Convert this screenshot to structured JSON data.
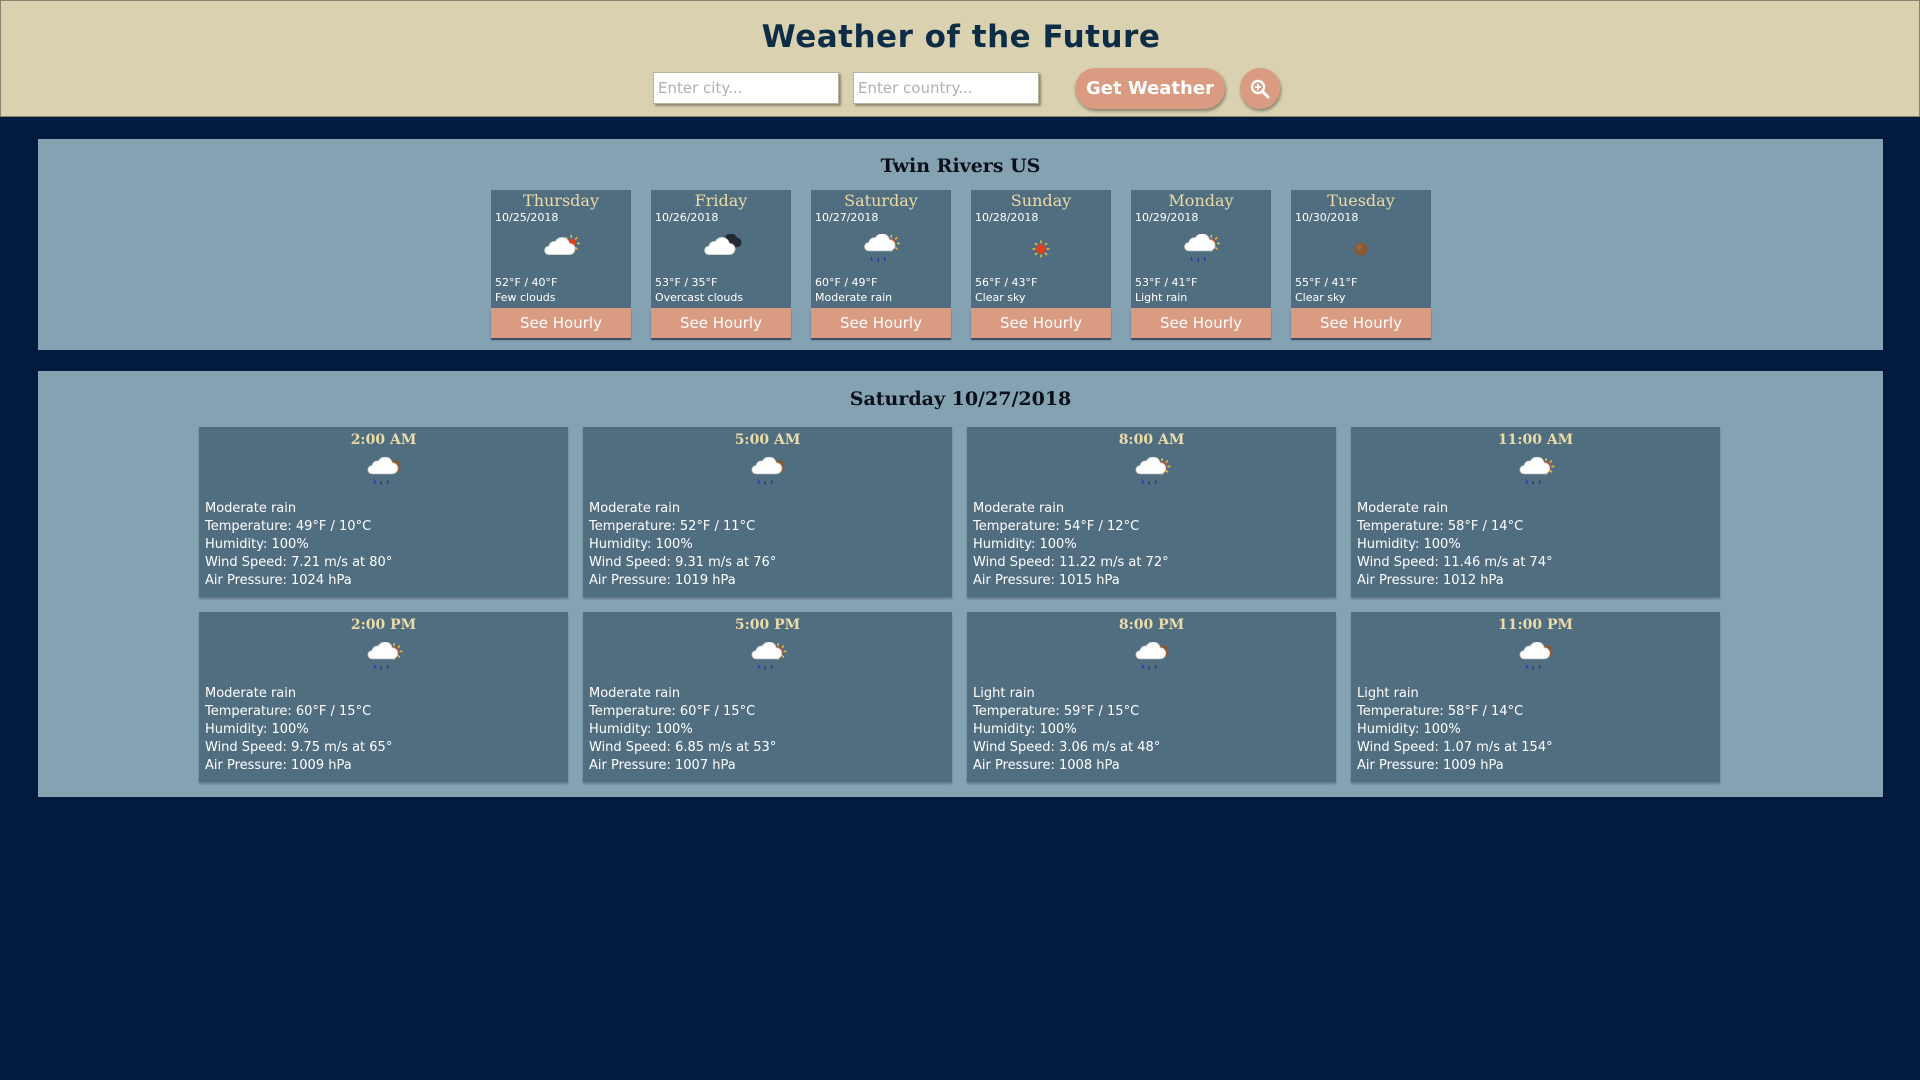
{
  "header": {
    "title": "Weather of the Future",
    "city_placeholder": "Enter city...",
    "country_placeholder": "Enter country...",
    "get_weather_label": "Get Weather",
    "zoom_icon": "zoom-icon"
  },
  "colors": {
    "background": "#011a3d",
    "header_bg": "#d9d1b0",
    "panel_bg": "#85a2b3",
    "card_bg": "#516e81",
    "accent": "#d99b82",
    "card_title": "#eadba8",
    "title_text": "#0d2d47"
  },
  "forecast": {
    "location": "Twin Rivers US",
    "days": [
      {
        "day": "Thursday",
        "date": "10/25/2018",
        "temp": "52°F / 40°F",
        "desc": "Few clouds",
        "icon": "few-clouds-day-icon",
        "button": "See Hourly"
      },
      {
        "day": "Friday",
        "date": "10/26/2018",
        "temp": "53°F / 35°F",
        "desc": "Overcast clouds",
        "icon": "overcast-clouds-night-icon",
        "button": "See Hourly"
      },
      {
        "day": "Saturday",
        "date": "10/27/2018",
        "temp": "60°F / 49°F",
        "desc": "Moderate rain",
        "icon": "rain-day-icon",
        "button": "See Hourly"
      },
      {
        "day": "Sunday",
        "date": "10/28/2018",
        "temp": "56°F / 43°F",
        "desc": "Clear sky",
        "icon": "sun-icon",
        "button": "See Hourly"
      },
      {
        "day": "Monday",
        "date": "10/29/2018",
        "temp": "53°F / 41°F",
        "desc": "Light rain",
        "icon": "rain-day-icon",
        "button": "See Hourly"
      },
      {
        "day": "Tuesday",
        "date": "10/30/2018",
        "temp": "55°F / 41°F",
        "desc": "Clear sky",
        "icon": "moon-icon",
        "button": "See Hourly"
      }
    ]
  },
  "hourly": {
    "heading": "Saturday 10/27/2018",
    "hours": [
      {
        "time": "2:00 AM",
        "icon": "rain-night-icon",
        "desc": "Moderate rain",
        "temperature": "Temperature: 49°F / 10°C",
        "humidity": "Humidity: 100%",
        "wind": "Wind Speed: 7.21 m/s at 80°",
        "pressure": "Air Pressure: 1024 hPa"
      },
      {
        "time": "5:00 AM",
        "icon": "rain-night-icon",
        "desc": "Moderate rain",
        "temperature": "Temperature: 52°F / 11°C",
        "humidity": "Humidity: 100%",
        "wind": "Wind Speed: 9.31 m/s at 76°",
        "pressure": "Air Pressure: 1019 hPa"
      },
      {
        "time": "8:00 AM",
        "icon": "rain-day-icon",
        "desc": "Moderate rain",
        "temperature": "Temperature: 54°F / 12°C",
        "humidity": "Humidity: 100%",
        "wind": "Wind Speed: 11.22 m/s at 72°",
        "pressure": "Air Pressure: 1015 hPa"
      },
      {
        "time": "11:00 AM",
        "icon": "rain-day-icon",
        "desc": "Moderate rain",
        "temperature": "Temperature: 58°F / 14°C",
        "humidity": "Humidity: 100%",
        "wind": "Wind Speed: 11.46 m/s at 74°",
        "pressure": "Air Pressure: 1012 hPa"
      },
      {
        "time": "2:00 PM",
        "icon": "rain-day-icon",
        "desc": "Moderate rain",
        "temperature": "Temperature: 60°F / 15°C",
        "humidity": "Humidity: 100%",
        "wind": "Wind Speed: 9.75 m/s at 65°",
        "pressure": "Air Pressure: 1009 hPa"
      },
      {
        "time": "5:00 PM",
        "icon": "rain-day-icon",
        "desc": "Moderate rain",
        "temperature": "Temperature: 60°F / 15°C",
        "humidity": "Humidity: 100%",
        "wind": "Wind Speed: 6.85 m/s at 53°",
        "pressure": "Air Pressure: 1007 hPa"
      },
      {
        "time": "8:00 PM",
        "icon": "rain-night-icon",
        "desc": "Light rain",
        "temperature": "Temperature: 59°F / 15°C",
        "humidity": "Humidity: 100%",
        "wind": "Wind Speed: 3.06 m/s at 48°",
        "pressure": "Air Pressure: 1008 hPa"
      },
      {
        "time": "11:00 PM",
        "icon": "rain-night-icon",
        "desc": "Light rain",
        "temperature": "Temperature: 58°F / 14°C",
        "humidity": "Humidity: 100%",
        "wind": "Wind Speed: 1.07 m/s at 154°",
        "pressure": "Air Pressure: 1009 hPa"
      }
    ]
  }
}
